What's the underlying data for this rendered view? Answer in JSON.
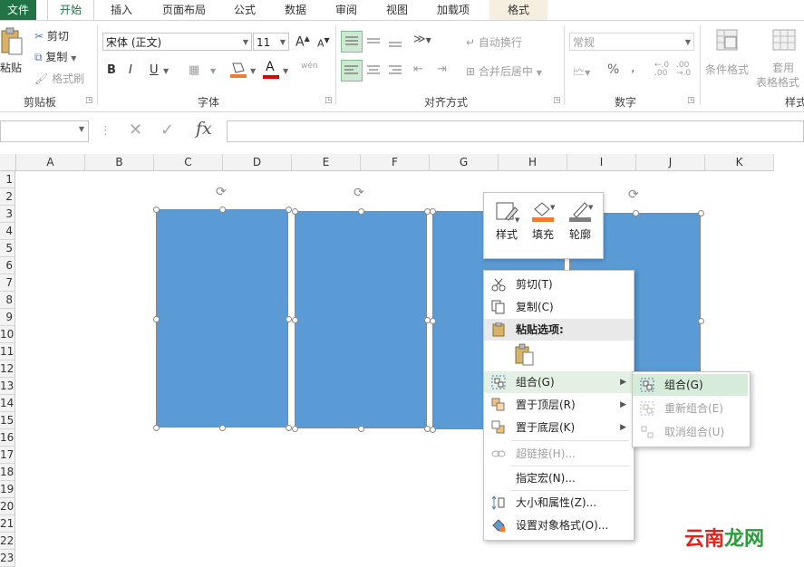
{
  "tabs": {
    "file": "文件",
    "home": "开始",
    "insert": "插入",
    "page_layout": "页面布局",
    "formulas": "公式",
    "data": "数据",
    "review": "审阅",
    "view": "视图",
    "addins": "加载项",
    "format": "格式"
  },
  "ribbon": {
    "clipboard": {
      "paste": "粘贴",
      "cut": "剪切",
      "copy": "复制",
      "format_painter": "格式刷",
      "label": "剪贴板"
    },
    "font": {
      "name": "宋体 (正文)",
      "size": "11",
      "grow": "A",
      "shrink": "A",
      "bold": "B",
      "italic": "I",
      "underline": "U",
      "font_color": "A",
      "phonetic": "wén",
      "label": "字体"
    },
    "alignment": {
      "wrap_text": "自动换行",
      "merge_center": "合并后居中",
      "label": "对齐方式"
    },
    "number": {
      "format": "常规",
      "percent": "%",
      "comma": ",",
      "label": "数字"
    },
    "styles": {
      "conditional": "条件格式",
      "table1": "套用",
      "table2": "表格格式",
      "label": "样式"
    }
  },
  "formula_bar": {
    "fx": "fx",
    "cancel": "✕",
    "enter": "✓",
    "value": ""
  },
  "columns": [
    "A",
    "B",
    "C",
    "D",
    "E",
    "F",
    "G",
    "H",
    "I",
    "J",
    "K"
  ],
  "rows": [
    "1",
    "2",
    "3",
    "4",
    "5",
    "6",
    "7",
    "8",
    "9",
    "10",
    "11",
    "12",
    "13",
    "14",
    "15",
    "16",
    "17",
    "18",
    "19",
    "20",
    "21",
    "22",
    "23"
  ],
  "mini_toolbar": {
    "style": "样式",
    "fill": "填充",
    "outline": "轮廓"
  },
  "context_menu": {
    "cut": "剪切(T)",
    "copy": "复制(C)",
    "paste_options": "粘贴选项:",
    "group": "组合(G)",
    "bring_to_front": "置于顶层(R)",
    "send_to_back": "置于底层(K)",
    "hyperlink": "超链接(H)...",
    "assign_macro": "指定宏(N)...",
    "size_properties": "大小和属性(Z)...",
    "format_object": "设置对象格式(O)..."
  },
  "submenu": {
    "group": "组合(G)",
    "regroup": "重新组合(E)",
    "ungroup": "取消组合(U)"
  },
  "watermark": {
    "part1": "云南",
    "part2": "龙网"
  },
  "colors": {
    "accent": "#217346",
    "shape_fill": "#5b9bd5",
    "fill_orange": "#ed7d31",
    "font_red": "#e00000",
    "watermark_red": "#e2231a",
    "watermark_green": "#2a9d3a"
  }
}
